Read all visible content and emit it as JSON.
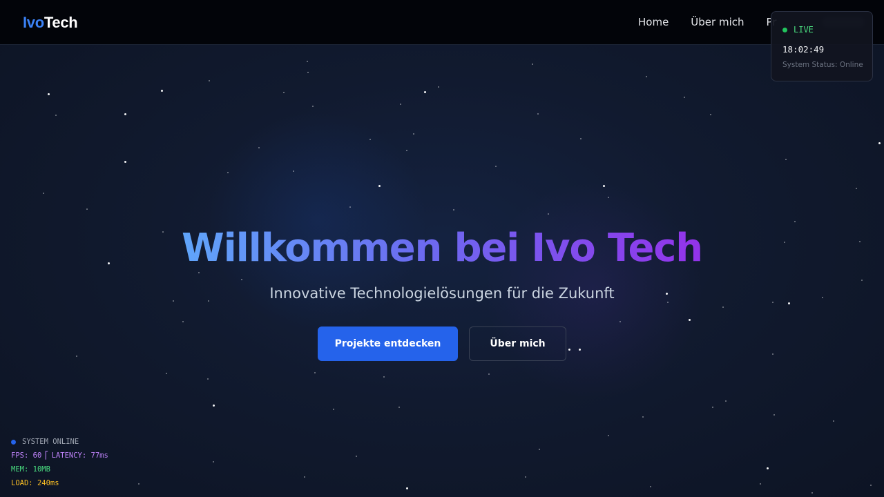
{
  "nav": {
    "logo_part1": "Ivo",
    "logo_part2": "Tech",
    "links": [
      "Home",
      "Über mich",
      "Pr"
    ]
  },
  "live_widget": {
    "label": "LIVE",
    "time": "18:02:49",
    "status": "System Status: Online"
  },
  "hero": {
    "title": "Willkommen bei Ivo Tech",
    "subtitle": "Innovative Technologielösungen für die Zukunft",
    "primary_button": "Projekte entdecken",
    "secondary_button": "Über mich"
  },
  "debug": {
    "system": "SYSTEM ONLINE",
    "fps_label": "FPS:",
    "fps": "60",
    "latency_label": "LATENCY:",
    "latency": "77ms",
    "mem_label": "MEM:",
    "mem": "10MB",
    "load_label": "LOAD:",
    "load": "240ms"
  },
  "colors": {
    "accent": "#2563eb",
    "live_green": "#22c55e",
    "gradient_start": "#60a5fa",
    "gradient_end": "#9333ea",
    "background": "#111a2f"
  }
}
